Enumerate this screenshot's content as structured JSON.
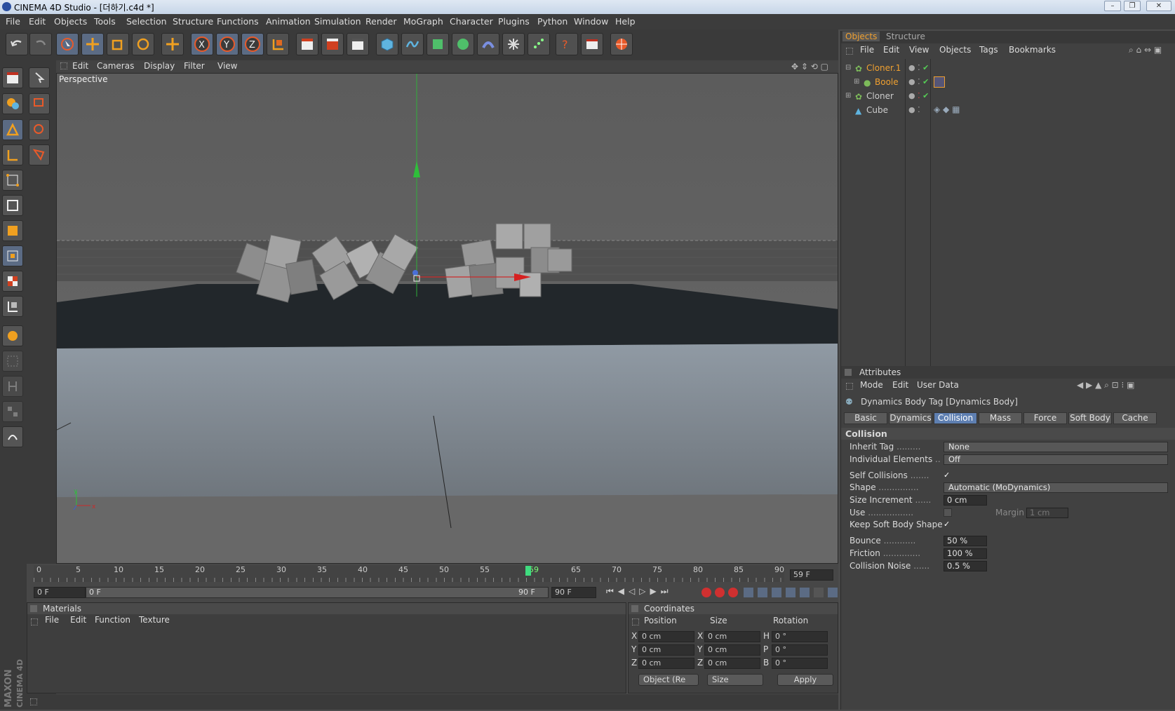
{
  "window": {
    "title": "CINEMA 4D Studio - [더하기.c4d *]"
  },
  "menubar": [
    "File",
    "Edit",
    "Objects",
    "Tools",
    "Selection",
    "Structure",
    "Functions",
    "Animation",
    "Simulation",
    "Render",
    "MoGraph",
    "Character",
    "Plugins",
    "Python",
    "Window",
    "Help"
  ],
  "viewport": {
    "menu": [
      "Edit",
      "Cameras",
      "Display",
      "Filter",
      "View"
    ],
    "label": "Perspective"
  },
  "timeline": {
    "ticks": [
      "0",
      "5",
      "10",
      "15",
      "20",
      "25",
      "30",
      "35",
      "40",
      "45",
      "50",
      "55",
      "59",
      "65",
      "70",
      "75",
      "80",
      "85",
      "90"
    ],
    "current_frame_box": "59 F",
    "start_field": "0 F",
    "range_start": "0 F",
    "range_end": "90 F",
    "end_field": "90 F",
    "current_fraction": 0.655
  },
  "materials": {
    "title": "Materials",
    "menu": [
      "File",
      "Edit",
      "Function",
      "Texture"
    ]
  },
  "coordinates": {
    "title": "Coordinates",
    "headers": [
      "Position",
      "Size",
      "Rotation"
    ],
    "rows": [
      {
        "a1": "X",
        "v1": "0 cm",
        "a2": "X",
        "v2": "0 cm",
        "a3": "H",
        "v3": "0 °"
      },
      {
        "a1": "Y",
        "v1": "0 cm",
        "a2": "Y",
        "v2": "0 cm",
        "a3": "P",
        "v3": "0 °"
      },
      {
        "a1": "Z",
        "v1": "0 cm",
        "a2": "Z",
        "v2": "0 cm",
        "a3": "B",
        "v3": "0 °"
      }
    ],
    "mode_dropdown": "Object (Re",
    "size_dropdown": "Size",
    "apply": "Apply"
  },
  "objects": {
    "tabs": [
      "Objects",
      "Structure"
    ],
    "menu": [
      "File",
      "Edit",
      "View",
      "Objects",
      "Tags",
      "Bookmarks"
    ],
    "tree": [
      {
        "name": "Cloner.1",
        "selected": true
      },
      {
        "name": "Boole",
        "selected": true
      },
      {
        "name": "Cloner",
        "selected": false
      },
      {
        "name": "Cube",
        "selected": false
      }
    ]
  },
  "attributes": {
    "title": "Attributes",
    "menu": [
      "Mode",
      "Edit",
      "User Data"
    ],
    "tag_title": "Dynamics Body Tag [Dynamics Body]",
    "tabs": [
      "Basic",
      "Dynamics",
      "Collision",
      "Mass",
      "Force",
      "Soft Body",
      "Cache"
    ],
    "active_tab": "Collision",
    "section": "Collision",
    "inherit_tag": {
      "label": "Inherit Tag",
      "value": "None"
    },
    "individual": {
      "label": "Individual Elements",
      "value": "Off"
    },
    "self_collisions": {
      "label": "Self Collisions",
      "value": "✓"
    },
    "shape": {
      "label": "Shape",
      "value": "Automatic (MoDynamics)"
    },
    "size_increment": {
      "label": "Size Increment",
      "value": "0 cm"
    },
    "use": {
      "label": "Use"
    },
    "margin": {
      "label": "Margin",
      "value": "1 cm"
    },
    "keep_soft": {
      "label": "Keep Soft Body Shape",
      "value": "✓"
    },
    "bounce": {
      "label": "Bounce",
      "value": "50 %"
    },
    "friction": {
      "label": "Friction",
      "value": "100 %"
    },
    "noise": {
      "label": "Collision Noise",
      "value": "0.5 %"
    }
  },
  "branding": "MAXON CINEMA 4D",
  "colors": {
    "accent": "#5e7fb1",
    "selected_object": "#f0a030",
    "background": "#4b4b4b"
  }
}
